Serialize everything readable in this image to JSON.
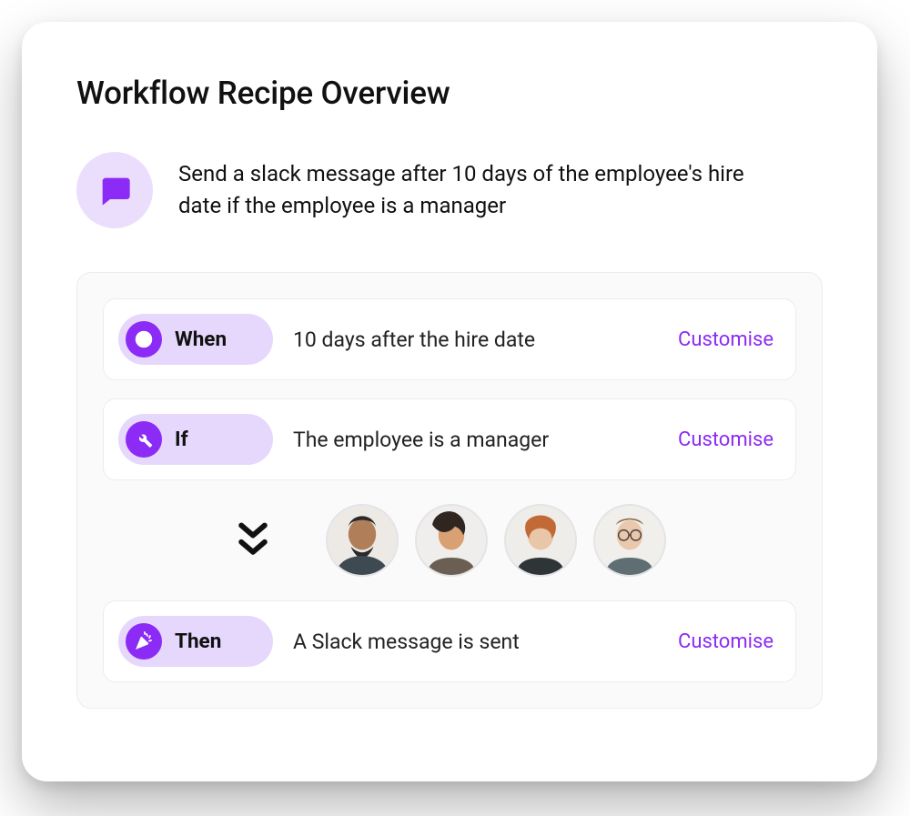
{
  "header": {
    "title": "Workflow Recipe Overview"
  },
  "summary": {
    "icon": "chat-icon",
    "text": "Send a slack message after 10 days of the employee's hire date if the employee is a manager"
  },
  "rules": {
    "when": {
      "pill_label": "When",
      "icon": "clock-icon",
      "description": "10 days after the hire date",
      "action_label": "Customise"
    },
    "if": {
      "pill_label": "If",
      "icon": "wrench-icon",
      "description": "The employee is a manager",
      "action_label": "Customise"
    },
    "then": {
      "pill_label": "Then",
      "icon": "party-icon",
      "description": "A Slack message is sent",
      "action_label": "Customise"
    }
  },
  "avatars": [
    {
      "name": "avatar-1",
      "skin": "#B07E58",
      "hair": "#2A2A2A"
    },
    {
      "name": "avatar-2",
      "skin": "#D9A074",
      "hair": "#2F2622"
    },
    {
      "name": "avatar-3",
      "skin": "#E8C6A8",
      "hair": "#C26A36"
    },
    {
      "name": "avatar-4",
      "skin": "#E9C8AE",
      "hair": "#8C6B42"
    }
  ],
  "colors": {
    "accent": "#8B2BF5",
    "accent_soft": "#E6D7FC",
    "accent_softer": "#EBDEFD",
    "panel_bg": "#FAFAFB",
    "border": "#ECECEE"
  }
}
